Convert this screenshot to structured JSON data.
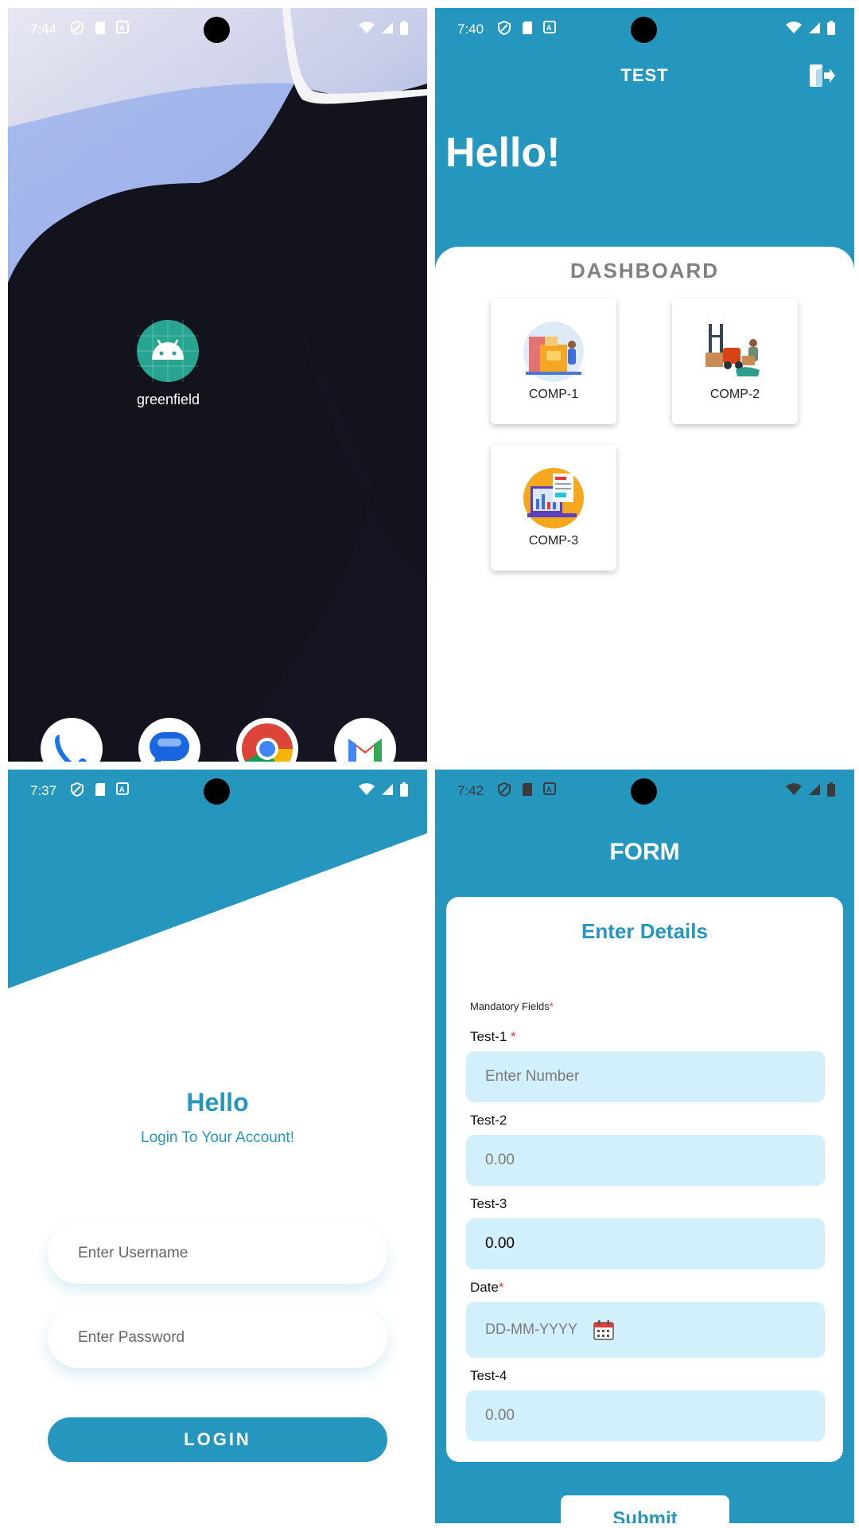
{
  "home": {
    "status": {
      "time": "7:44"
    },
    "app": {
      "label": "greenfield"
    },
    "dock": [
      "phone-icon",
      "messages-icon",
      "chrome-icon",
      "gmail-icon"
    ]
  },
  "dashboard": {
    "status": {
      "time": "7:40"
    },
    "title": "TEST",
    "greeting": "Hello!",
    "section_title": "DASHBOARD",
    "tiles": [
      {
        "label": "COMP-1",
        "icon": "warehouse-illustration-icon"
      },
      {
        "label": "COMP-2",
        "icon": "forklift-illustration-icon"
      },
      {
        "label": "COMP-3",
        "icon": "report-illustration-icon"
      }
    ]
  },
  "login": {
    "status": {
      "time": "7:37"
    },
    "title": "Hello",
    "subtitle": "Login To Your Account!",
    "username_placeholder": "Enter Username",
    "password_placeholder": "Enter Password",
    "button_label": "LOGIN"
  },
  "form": {
    "status": {
      "time": "7:42"
    },
    "title": "FORM",
    "card_title": "Enter Details",
    "mandatory_note": "Mandatory Fields",
    "required_mark": "*",
    "fields": [
      {
        "label": "Test-1",
        "placeholder": "Enter Number",
        "required": true
      },
      {
        "label": "Test-2",
        "placeholder": "0.00",
        "required": false
      },
      {
        "label": "Test-3",
        "value": "0.00",
        "required": false
      },
      {
        "label": "Date",
        "placeholder": "DD-MM-YYYY",
        "required": true
      },
      {
        "label": "Test-4",
        "placeholder": "0.00",
        "required": false
      }
    ],
    "submit_label": "Submit"
  },
  "colors": {
    "primary": "#2596be",
    "input_bg": "#d2f0fb",
    "required": "#e53935"
  }
}
